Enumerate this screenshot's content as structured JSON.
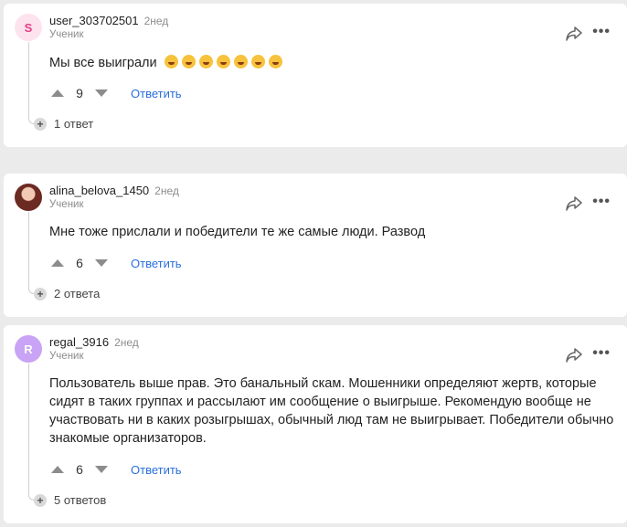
{
  "comments": [
    {
      "username": "user_303702501",
      "time": "2нед",
      "role": "Ученик",
      "avatar_letter": "S",
      "text": "Мы все выиграли",
      "emoji": [
        "rofl-emoji",
        "rofl-emoji",
        "rofl-emoji",
        "rofl-emoji",
        "rofl-emoji",
        "rofl-emoji",
        "rofl-emoji"
      ],
      "votes": "9",
      "reply_label": "Ответить",
      "replies": "1 ответ"
    },
    {
      "username": "alina_belova_1450",
      "time": "2нед",
      "role": "Ученик",
      "avatar_letter": "",
      "text": "Мне тоже прислали и победители те же самые люди. Развод",
      "votes": "6",
      "reply_label": "Ответить",
      "replies": "2 ответа"
    },
    {
      "username": "regal_3916",
      "time": "2нед",
      "role": "Ученик",
      "avatar_letter": "R",
      "text": "Пользователь выше прав. Это банальный скам. Мошенники определяют жертв, которые сидят в таких группах и рассылают им сообщение о выигрыше. Рекомендую вообще не участвовать ни в каких розыгрышах, обычный люд там не выигрывает. Победители обычно знакомые организаторов.",
      "votes": "6",
      "reply_label": "Ответить",
      "replies": "5 ответов"
    }
  ],
  "icons": {
    "share": "share-arrow-icon",
    "more": "more-dots-icon",
    "upvote": "upvote-arrow-icon",
    "downvote": "downvote-arrow-icon",
    "expand": "plus-icon"
  },
  "colors": {
    "link": "#2a6fdb",
    "background": "#ebebeb",
    "avatar_s_bg": "#fde3ee",
    "avatar_r_bg": "#c9a3f5"
  }
}
